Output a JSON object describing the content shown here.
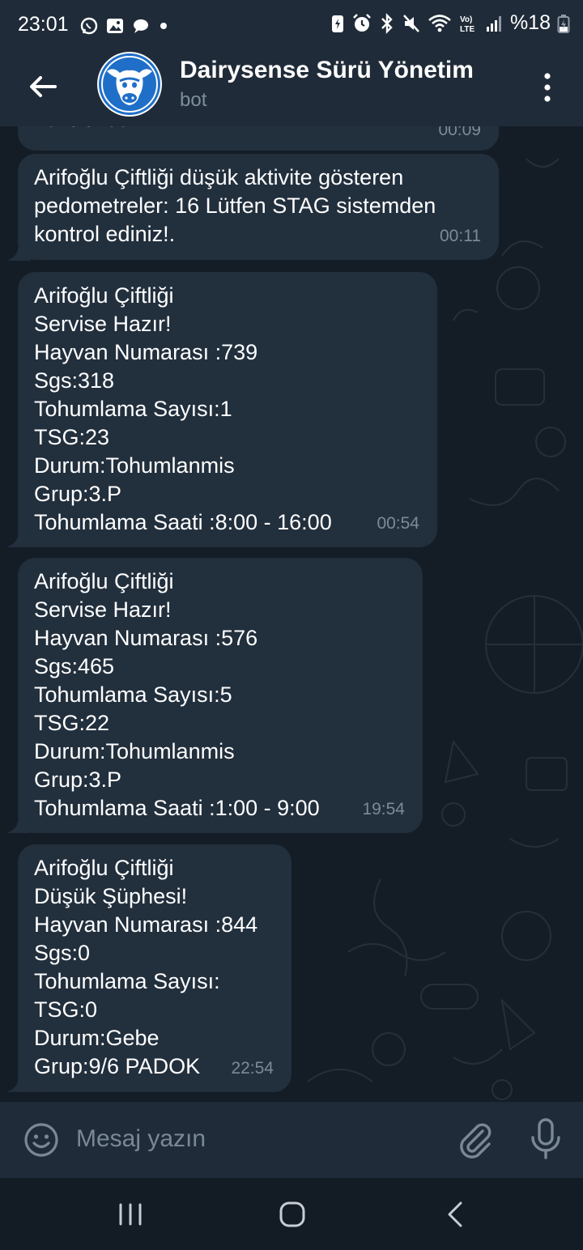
{
  "status_bar": {
    "time": "23:01",
    "battery": "%18",
    "icons_left": [
      "whatsapp-icon",
      "gallery-icon",
      "message-icon",
      "dot-icon"
    ],
    "icons_right": [
      "battery-saver-icon",
      "alarm-icon",
      "bluetooth-icon",
      "mute-icon",
      "wifi-icon",
      "volte-icon",
      "signal-icon",
      "battery-icon"
    ]
  },
  "header": {
    "title": "Dairysense Sürü Yönetim",
    "subtitle": "bot",
    "back_icon": "arrow-left-icon",
    "menu_icon": "more-vertical-icon"
  },
  "messages": [
    {
      "lines": [
        "kontrol ediniz!."
      ],
      "time": "00:09"
    },
    {
      "lines": [
        "Arifoğlu Çiftliği düşük aktivite gösteren",
        "pedometreler: 16 Lütfen STAG sistemden",
        "kontrol ediniz!."
      ],
      "time": "00:11"
    },
    {
      "lines": [
        "Arifoğlu Çiftliği",
        "Servise Hazır!",
        "Hayvan Numarası :739",
        "Sgs:318",
        "Tohumlama Sayısı:1",
        "TSG:23",
        "Durum:Tohumlanmis",
        "Grup:3.P",
        "Tohumlama Saati :8:00 - 16:00"
      ],
      "time": "00:54"
    },
    {
      "lines": [
        "Arifoğlu Çiftliği",
        "Servise Hazır!",
        "Hayvan Numarası :576",
        "Sgs:465",
        "Tohumlama Sayısı:5",
        "TSG:22",
        "Durum:Tohumlanmis",
        "Grup:3.P",
        "Tohumlama Saati :1:00 - 9:00"
      ],
      "time": "19:54"
    },
    {
      "lines": [
        "Arifoğlu Çiftliği",
        "Düşük Şüphesi!",
        "Hayvan Numarası :844",
        "Sgs:0",
        "Tohumlama Sayısı:",
        "TSG:0",
        "Durum:Gebe",
        "Grup:9/6 PADOK"
      ],
      "time": "22:54"
    }
  ],
  "input": {
    "placeholder": "Mesaj yazın",
    "emoji_icon": "emoji-icon",
    "attach_icon": "paperclip-icon",
    "mic_icon": "microphone-icon"
  },
  "nav_bar": {
    "recents_icon": "recents-icon",
    "home_icon": "home-icon",
    "back_icon": "chevron-left-icon"
  },
  "colors": {
    "header_bg": "#1f2b38",
    "chat_bg": "#141d26",
    "bubble_bg": "#222f3d",
    "meta_text": "#7c8a99",
    "avatar_blue": "#1f6fc8"
  }
}
